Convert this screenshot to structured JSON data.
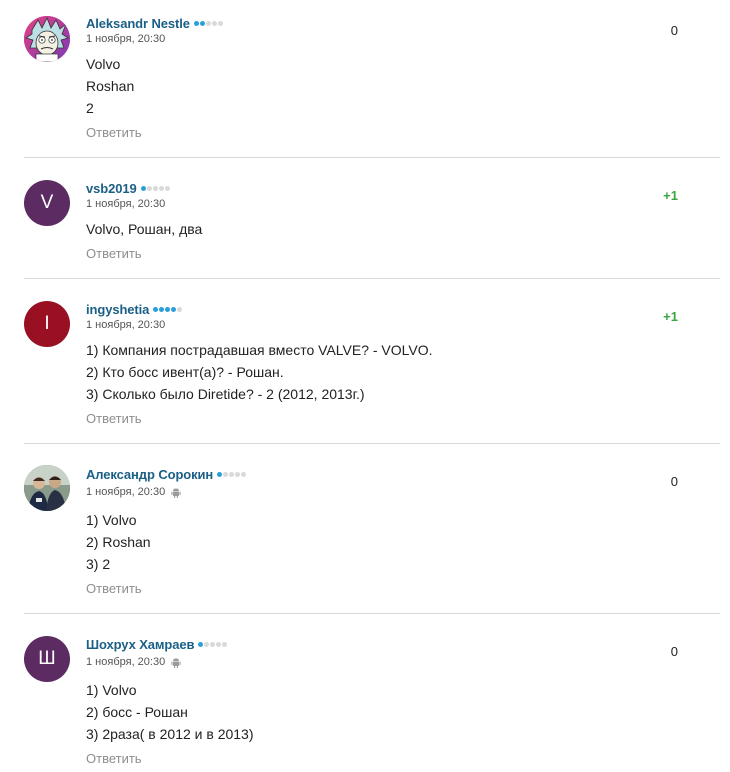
{
  "comments": [
    {
      "author": "Aleksandr Nestle",
      "rating_level": 2,
      "time": "1 ноября, 20:30",
      "device": "",
      "avatar": {
        "type": "image",
        "icon": "rick-cartoon-avatar"
      },
      "lines": [
        "Volvo",
        "Roshan",
        "2"
      ],
      "reply": "Ответить",
      "score": "0"
    },
    {
      "author": "vsb2019",
      "rating_level": 1,
      "time": "1 ноября, 20:30",
      "device": "",
      "avatar": {
        "type": "letter",
        "letter": "V",
        "color": "#5b2b62"
      },
      "lines": [
        "Volvo, Рошан, два"
      ],
      "reply": "Ответить",
      "score": "+1"
    },
    {
      "author": "ingyshetia",
      "rating_level": 4,
      "time": "1 ноября, 20:30",
      "device": "",
      "avatar": {
        "type": "letter",
        "letter": "I",
        "color": "#9a1023"
      },
      "lines": [
        "1) Компания пострадавшая вместо VALVE? - VOLVO.",
        "2) Кто босс ивент(а)? - Рошан.",
        "3) Сколько было Diretide? - 2 (2012, 2013г.)"
      ],
      "reply": "Ответить",
      "score": "+1"
    },
    {
      "author": "Александр Сорокин",
      "rating_level": 1,
      "time": "1 ноября, 20:30",
      "device": "android-icon",
      "avatar": {
        "type": "image",
        "icon": "photo-avatar"
      },
      "lines": [
        "1) Volvo",
        "2) Roshan",
        "3) 2"
      ],
      "reply": "Ответить",
      "score": "0"
    },
    {
      "author": "Шохрух Хамраев",
      "rating_level": 1,
      "time": "1 ноября, 20:30",
      "device": "android-icon",
      "avatar": {
        "type": "letter",
        "letter": "Ш",
        "color": "#5b2b62"
      },
      "lines": [
        "1) Volvo",
        "2) босс - Рошан",
        "3) 2раза( в 2012 и в 2013)"
      ],
      "reply": "Ответить",
      "score": "0"
    }
  ],
  "colors": {
    "author": "#1b5f87",
    "rating_on": "#2a9fd8",
    "rating_off": "#d9d9d9",
    "positive_score": "#3aa63f",
    "reply": "#8e8e8e",
    "divider": "#d9d9d9"
  }
}
